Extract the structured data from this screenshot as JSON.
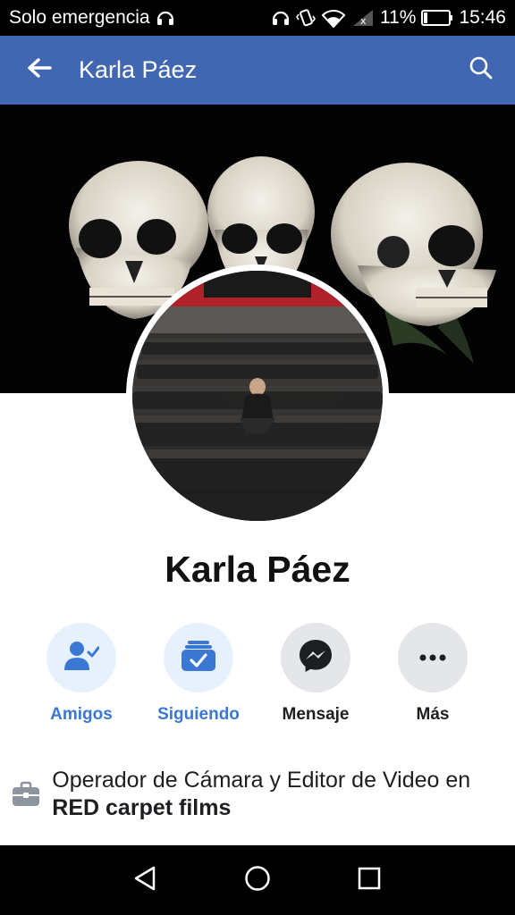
{
  "status_bar": {
    "carrier": "Solo emergencia",
    "battery": "11%",
    "time": "15:46",
    "icons": [
      "headset-icon",
      "headphones-icon",
      "vibrate-icon",
      "wifi-icon",
      "signal-icon",
      "battery-icon"
    ]
  },
  "app_bar": {
    "title": "Karla Páez",
    "back_icon": "arrow-left-icon",
    "search_icon": "search-icon",
    "color": "#4267b2"
  },
  "profile": {
    "name": "Karla Páez"
  },
  "actions": [
    {
      "label": "Amigos",
      "icon": "friends-icon"
    },
    {
      "label": "Siguiendo",
      "icon": "following-icon"
    },
    {
      "label": "Mensaje",
      "icon": "messenger-icon"
    },
    {
      "label": "Más",
      "icon": "more-icon"
    }
  ],
  "job": {
    "prefix": "Operador de Cámara y Editor de Video en ",
    "company": "RED carpet films",
    "icon": "briefcase-icon"
  },
  "nav_bar": {
    "icons": [
      "back-triangle-icon",
      "home-circle-icon",
      "recents-square-icon"
    ]
  },
  "colors": {
    "accent": "#4267b2",
    "link_blue": "#3b78d4"
  }
}
